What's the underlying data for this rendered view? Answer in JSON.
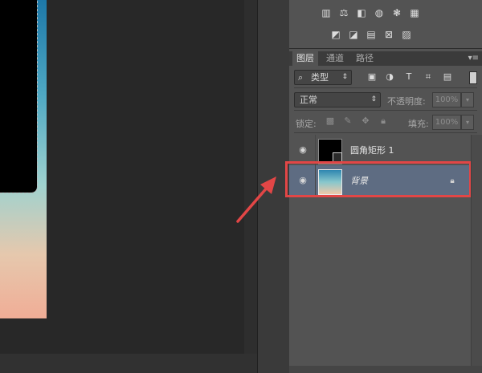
{
  "adjustments": {
    "row1_icons": [
      "levels-icon",
      "balance-icon",
      "half-square-icon",
      "camera-filter-icon",
      "color-dots-icon",
      "grid-icon"
    ],
    "row2_icons": [
      "curves-icon",
      "diagonal-gradient-icon",
      "map-icon",
      "selective-icon",
      "gradient-square-icon"
    ]
  },
  "layers_panel": {
    "tabs": [
      "图层",
      "通道",
      "路径"
    ],
    "active_tab": "图层",
    "menu_glyph": "▾≡",
    "filter": {
      "type_label": "类型",
      "toggle_icons": [
        "image-icon",
        "circle-half-icon",
        "text-T-icon",
        "transform-icon",
        "smart-object-icon"
      ]
    },
    "blend_mode": "正常",
    "opacity_label": "不透明度:",
    "opacity_value": "100%",
    "lock_label": "锁定:",
    "fill_label": "填充:",
    "fill_value": "100%",
    "layers": [
      {
        "name": "圆角矩形 1",
        "visible": true,
        "selected": false,
        "thumb": "black-rounded-rect",
        "locked": false
      },
      {
        "name": "背景",
        "visible": true,
        "selected": true,
        "thumb": "gradient-background",
        "locked": true,
        "italic": true
      }
    ]
  },
  "annotation": {
    "highlight_color": "#e24646",
    "arrow_color": "#e24646"
  }
}
